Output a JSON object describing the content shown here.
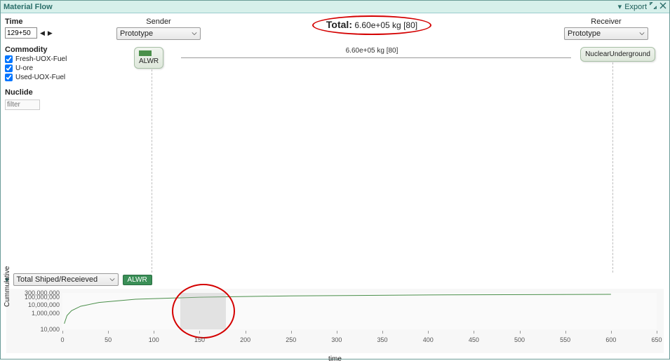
{
  "panel": {
    "title": "Material Flow",
    "export_label": "Export"
  },
  "sidebar": {
    "time_label": "Time",
    "time_value": "129+50",
    "commodity_label": "Commodity",
    "commodities": [
      {
        "label": "Fresh-UOX-Fuel",
        "checked": true
      },
      {
        "label": "U-ore",
        "checked": true
      },
      {
        "label": "Used-UOX-Fuel",
        "checked": true
      }
    ],
    "nuclide_label": "Nuclide",
    "filter_placeholder": "filter"
  },
  "canvas": {
    "sender_label": "Sender",
    "receiver_label": "Receiver",
    "group_select_value": "Prototype",
    "total_prefix": "Total:",
    "total_value": "6.60e+05 kg [80]",
    "edge_label": "6.60e+05 kg [80]",
    "sender_node": "ALWR",
    "receiver_node": "NuclearUnderground"
  },
  "bottom": {
    "metric_select": "Total Shiped/Receieved",
    "tag": "ALWR",
    "ylabel": "Cummulative",
    "xlabel": "time"
  },
  "chart_data": {
    "type": "line",
    "title": "",
    "xlabel": "time",
    "ylabel": "Cummulative",
    "x_range": [
      0,
      650
    ],
    "yscale": "log",
    "y_range": [
      10000,
      300000000
    ],
    "y_ticks": [
      10000,
      1000000,
      10000000,
      100000000,
      300000000
    ],
    "y_tick_labels": [
      "10,000",
      "1,000,000",
      "10,000,000",
      "100,000,000",
      "300,000,000"
    ],
    "x_ticks": [
      0,
      50,
      100,
      150,
      200,
      250,
      300,
      350,
      400,
      450,
      500,
      550,
      600,
      650
    ],
    "brush_range": [
      129,
      179
    ],
    "series": [
      {
        "name": "ALWR",
        "color": "#4a8f4a",
        "x": [
          2,
          5,
          10,
          20,
          40,
          80,
          150,
          250,
          400,
          600
        ],
        "y": [
          50000,
          500000,
          2000000,
          7000000,
          20000000,
          50000000,
          90000000,
          130000000,
          170000000,
          200000000
        ]
      }
    ]
  }
}
